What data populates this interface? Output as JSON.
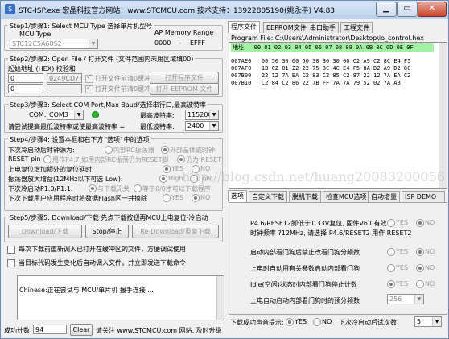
{
  "window": {
    "title": "STC-ISP.exe   宏晶科技官方网站：www.STCMCU.com  技术支持：13922805190(姚永平)   V4.83"
  },
  "step1": {
    "title": "Step1/步骤1: Select MCU Type  选择单片机型号",
    "mcu_type_label": "MCU Type",
    "ap_memory_label": "AP Memory Range",
    "mcu_value": "STC12C5A60S2",
    "range_start": "0000",
    "range_sep": "-",
    "range_end": "EFFF"
  },
  "step2": {
    "title": "Step2/步骤2: Open File / 打开文件 (文件范围内未用区域填00)",
    "addr_label": "起始地址 (HEX)  校验和",
    "addr1": "0",
    "checksum1": "0249CD7H",
    "clear_before_open1": "打开文件前清0缓冲",
    "open_program_button": "打开程序文件",
    "addr2": "0",
    "clear_before_open2": "打开文件前清0缓冲",
    "open_eeprom_button": "打开 EEPROM 文件"
  },
  "step3": {
    "title": "Step3/步骤3: Select COM Port,Max Baud/选择串行口,最高波特率",
    "com_label": "COM:",
    "com_value": "COM3",
    "max_baud_label": "最高波特率:",
    "max_baud_value": "115200",
    "min_baud_note": "请尝试提高最低波特率或使最高波特率 =",
    "min_baud_label": "最低波特率:",
    "min_baud_value": "2400"
  },
  "step4": {
    "title": "Step4/步骤4: 设置本框和右下方 '选项' 中的选项",
    "next_clock_label": "下次冷启动后时钟源为:",
    "clock_internal": "内部RC振荡器",
    "clock_external": "外部晶体或时钟",
    "reset_label": "RESET pin",
    "reset_io": "用作P4.7,如用内部RC振荡仍为RESET脚",
    "reset_keep": "仍为 RESET",
    "power_delay_label": "上电复位增加额外的复位延时:",
    "yes": "YES",
    "no": "NO",
    "osc_gain_label": "振荡器放大增益(12MHz以下可选 Low):",
    "high": "High",
    "low": "Low",
    "p10_label": "下次冷启动P1.0/P1.1:",
    "p10_opt1": "与下载无关",
    "p10_opt2": "等于0/0才可以下载程序",
    "erase_flash_label": "下次下载用户应用程序时将数据Flash区一并擦除"
  },
  "step5": {
    "title": "Step5/步骤5: Download/下载  先点下载按钮再MCU上电复位-冷启动",
    "download_button": "Download/下载",
    "stop_button": "Stop/停止",
    "redownload_button": "Re-Download/重复下载",
    "reload_each_time": "每次下载前重新调入已打开在缓冲区的文件，方便调试使用",
    "auto_reload_on_change": "当目标代码发生变化后自动调入文件，并立即发送下载命令"
  },
  "log": {
    "text": "Chinese:正在尝试与 MCU/单片机 握手连接 ..."
  },
  "statusbar": {
    "success_count_label": "成功计数",
    "success_count": "94",
    "clear_button": "Clear",
    "website_note": "请关注 www.STCMCU.com 网站, 及时升级"
  },
  "top_tabs": [
    "程序文件",
    "EEPROM文件",
    "串口助手",
    "工程文件"
  ],
  "program_file_path": "Program File: C:\\Users\\Administrator\\Desktop\\io_control.hex",
  "hex": {
    "header": "地址   00 01 02 03 04 05 06 07 08 09 0A 0B 0C 0D 0E 0F",
    "rows": [
      "007AE0   00 50 30 00 50 30 30 30 00 C2 A9 C2 8C E4 F5",
      "007AF0   1B C2 81 22 22 75 8C 4C E4 F5 8A D2 A9 D2 8C",
      "007B00   22 12 7A EA C2 83 C2 85 C2 87 22 12 7A EA C2",
      "007B10   C2 84 C2 86 22 7B FF 7A 7A 79 52 02 7A AB"
    ]
  },
  "bottom_tabs": [
    "选项",
    "自定义下载",
    "脱机下载",
    "检查MCU选项",
    "自动增量",
    "ISP DEMO"
  ],
  "options": {
    "p46_label": "P4.6/RESET2脚低于1.33V复位, 固件V6.0有效",
    "p46_yes": "YES",
    "p46_no": "NO",
    "clock_note": "时钟频率 ?12MHz, 请选择 P4.6/RESET2 用作 RESET2",
    "watchdog_label": "启动内部看门狗后禁止改看门狗分频数",
    "poweron_watchdog_label": "上电时自动用有关参数启动内部看门狗",
    "idle_label": "Idle(空闲)状态时内部看门狗停止计数",
    "prescale_label": "上电自动启动内部看门狗时的预分频数",
    "prescale_value": "256",
    "yes": "YES",
    "no": "NO"
  },
  "bottom_status": {
    "beep_label": "下载成功声音提示:",
    "yes": "YES",
    "no": "NO",
    "retry_label": "下次冷启动后试次数",
    "retry_value": "5"
  },
  "watermark": "http://blog.csdn.net/huang20083200056"
}
